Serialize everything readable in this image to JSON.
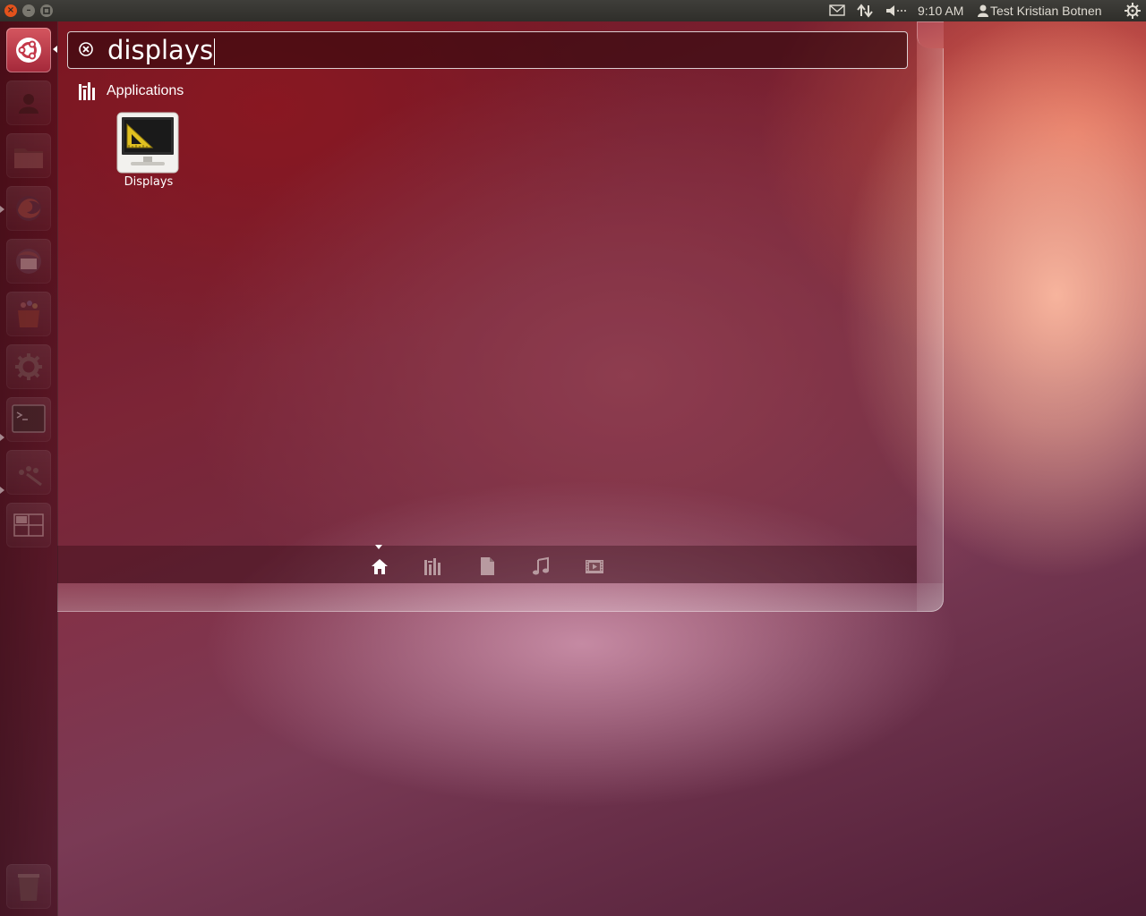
{
  "window_controls": {
    "close_glyph": "×"
  },
  "panel": {
    "clock": "9:10 AM",
    "user": "Test Kristian Botnen",
    "indicators": [
      "mail-icon",
      "network-icon",
      "sound-icon",
      "session-gear-icon"
    ]
  },
  "launcher": {
    "items": [
      "dash-home-icon",
      "contacts-icon",
      "files-icon",
      "firefox-icon",
      "thunderbird-icon",
      "software-center-icon",
      "system-settings-icon",
      "terminal-icon",
      "network-tools-icon",
      "workspace-switcher-icon",
      "trash-icon"
    ]
  },
  "search": {
    "query": "displays"
  },
  "results": {
    "category": "Applications",
    "items": [
      {
        "label": "Displays",
        "icon": "displays-app-icon"
      }
    ]
  },
  "lenses": [
    "home-lens-icon",
    "applications-lens-icon",
    "files-lens-icon",
    "music-lens-icon",
    "video-lens-icon"
  ],
  "colors": {
    "accent": "#dd4814",
    "panel": "#3c3b37"
  }
}
